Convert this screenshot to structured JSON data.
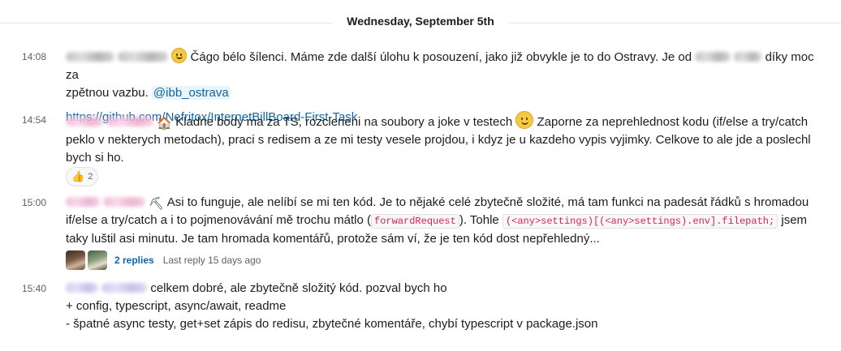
{
  "day_divider": "Wednesday, September 5th",
  "messages": [
    {
      "time": "14:08",
      "text_1": "Čágo bélo šílenci. Máme zde další úlohu k posouzení, jako již obvykle je to do Ostravy. Je od",
      "text_2": "díky moc za",
      "text_3": "zpětnou vazbu.",
      "mention": "@ibb_ostrava",
      "link": "https://github.com/Nefritox/InternetBillBoard-First-Task"
    },
    {
      "time": "14:54",
      "text_1": "Kladne body ma za TS, rozcleneni na soubory a joke v testech",
      "text_2": "Zaporne za neprehlednost kodu (if/else a try/catch",
      "text_3": "peklo v nekterych metodach), praci s redisem a ze mi testy vesele projdou, i kdyz je u kazdeho vypis vyjimky. Celkove to ale jde a poslechl",
      "text_4": "bych si ho.",
      "reaction_count": "2"
    },
    {
      "time": "15:00",
      "text_1": "Asi to funguje, ale nelíbí se mi ten kód. Je to nějaké celé zbytečně složité, má tam funkci na padesát řádků s hromadou",
      "text_2": "if/else a try/catch a i to pojmenovávání mě trochu mátlo (",
      "code_1": "forwardRequest",
      "text_3": "). Tohle",
      "code_2": "(<any>settings)[(<any>settings).env].filepath;",
      "text_4": "jsem",
      "text_5": "taky luštil asi minutu. Je tam hromada komentářů, protože sám ví, že je ten kód dost nepřehledný...",
      "replies": "2 replies",
      "last_reply": "Last reply 15 days ago"
    },
    {
      "time": "15:40",
      "text_1": "celkem dobré, ale zbytečně složitý kód. pozval bych ho",
      "text_2": "+ config, typescript, async/await, readme",
      "text_3": "- špatné async testy, get+set zápis do redisu, zbytečné komentáře, chybí typescript v package.json"
    }
  ],
  "icons": {
    "house": "🏠",
    "pick": "⛏",
    "thumbs_up": "👍"
  },
  "colors": {
    "link": "#1264a3",
    "code": "#e01e5a",
    "timestamp": "#616061"
  }
}
